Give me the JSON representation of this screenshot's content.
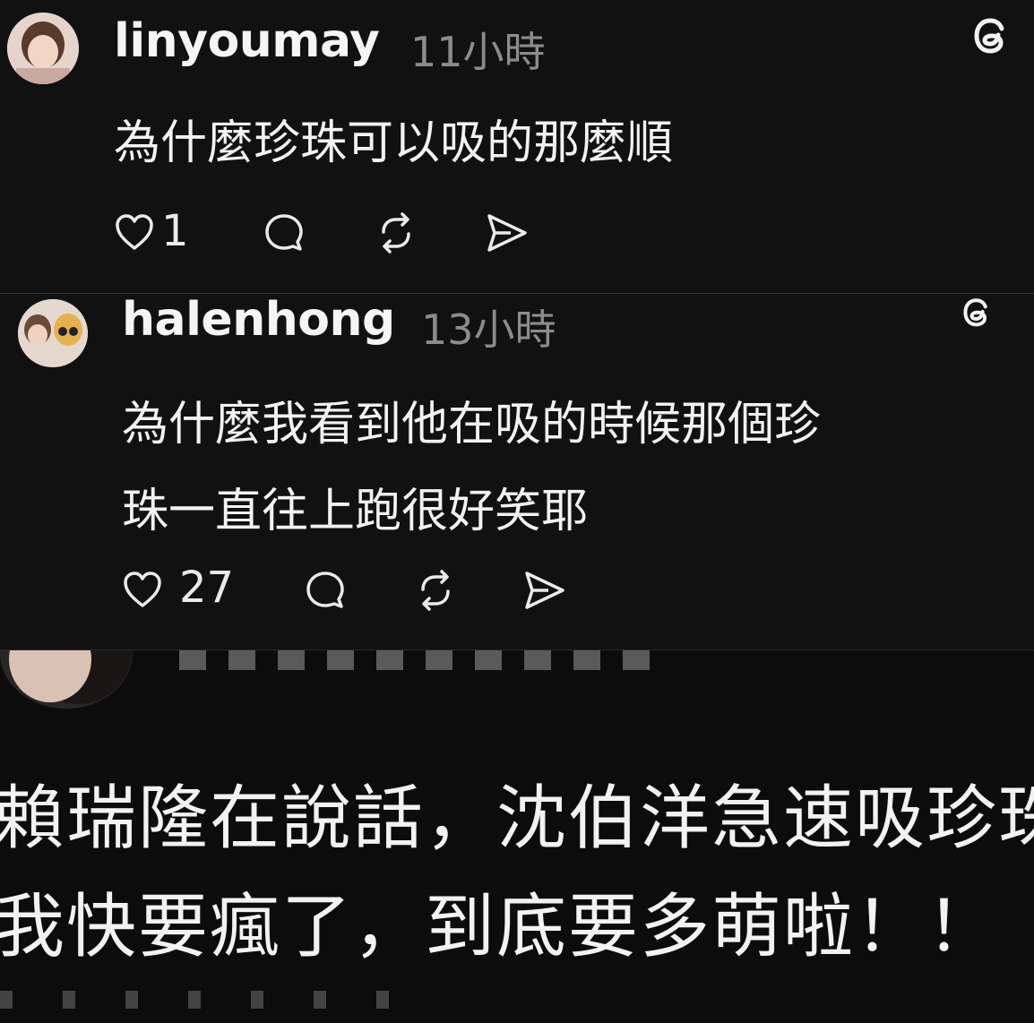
{
  "comments": [
    {
      "username": "linyoumay",
      "time": "11小時",
      "text": "為什麼珍珠可以吸的那麼順",
      "likes": "1"
    },
    {
      "username": "halenhong",
      "time": "13小時",
      "text_line1": "為什麼我看到他在吸的時候那個珍",
      "text_line2": "珠一直往上跑很好笑耶",
      "likes": "27"
    },
    {
      "text_line1": "賴瑞隆在說話，沈伯洋急速吸珍珠",
      "text_line2": "我快要瘋了，到底要多萌啦！！"
    }
  ],
  "icons": {
    "like": "heart-icon",
    "reply": "comment-icon",
    "repost": "repost-icon",
    "share": "send-icon",
    "brand": "threads-logo-icon"
  },
  "colors": {
    "background": "#111111",
    "text": "#f2f2f2",
    "muted": "#8c8c8c"
  }
}
